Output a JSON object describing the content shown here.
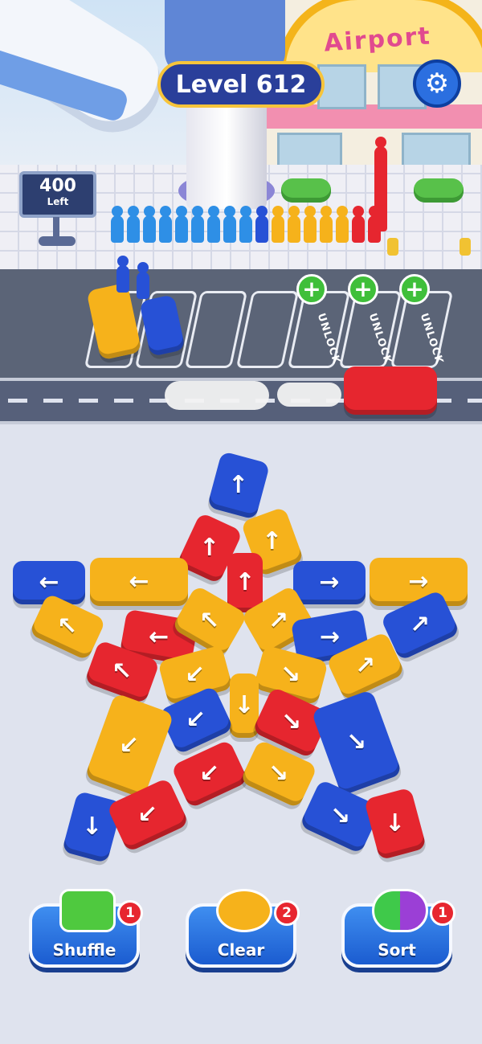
{
  "hud": {
    "level_label": "Level 612",
    "settings_icon": "gear-icon",
    "passengers_left_count": "400",
    "passengers_left_label": "Left"
  },
  "scene": {
    "terminal_sign": "Airport"
  },
  "parking": {
    "slots": [
      {
        "state": "occupied",
        "vehicle": "yellow-bus"
      },
      {
        "state": "occupied",
        "vehicle": "blue-car"
      },
      {
        "state": "empty"
      },
      {
        "state": "empty"
      },
      {
        "state": "locked",
        "label": "UNLOCK"
      },
      {
        "state": "locked",
        "label": "UNLOCK"
      },
      {
        "state": "locked",
        "label": "UNLOCK"
      }
    ]
  },
  "board": {
    "vehicles": [
      {
        "color": "blue",
        "arrow": "↑"
      },
      {
        "color": "red",
        "arrow": "↑"
      },
      {
        "color": "yellow",
        "arrow": "↑"
      },
      {
        "color": "red",
        "arrow": "↑"
      },
      {
        "color": "blue",
        "arrow": "←"
      },
      {
        "color": "yellow",
        "arrow": "←"
      },
      {
        "color": "blue",
        "arrow": "→"
      },
      {
        "color": "yellow",
        "arrow": "→"
      },
      {
        "color": "yellow",
        "arrow": "↖"
      },
      {
        "color": "red",
        "arrow": "←"
      },
      {
        "color": "yellow",
        "arrow": "↖"
      },
      {
        "color": "yellow",
        "arrow": "↗"
      },
      {
        "color": "blue",
        "arrow": "→"
      },
      {
        "color": "blue",
        "arrow": "↗"
      },
      {
        "color": "red",
        "arrow": "↖"
      },
      {
        "color": "yellow",
        "arrow": "↙"
      },
      {
        "color": "yellow",
        "arrow": "↘"
      },
      {
        "color": "yellow",
        "arrow": "↗"
      },
      {
        "color": "yellow",
        "arrow": "↓"
      },
      {
        "color": "blue",
        "arrow": "↙"
      },
      {
        "color": "red",
        "arrow": "↘"
      },
      {
        "color": "yellow",
        "arrow": "↙"
      },
      {
        "color": "blue",
        "arrow": "↘"
      },
      {
        "color": "red",
        "arrow": "↙"
      },
      {
        "color": "yellow",
        "arrow": "↘"
      },
      {
        "color": "blue",
        "arrow": "↓"
      },
      {
        "color": "red",
        "arrow": "↙"
      },
      {
        "color": "blue",
        "arrow": "↘"
      },
      {
        "color": "red",
        "arrow": "↓"
      }
    ]
  },
  "boosters": {
    "shuffle": {
      "label": "Shuffle",
      "count": "1",
      "icon": "green-car-shuffle-icon"
    },
    "clear": {
      "label": "Clear",
      "count": "2",
      "icon": "helicopter-icon"
    },
    "sort": {
      "label": "Sort",
      "count": "1",
      "icon": "people-sort-icon"
    }
  },
  "colors": {
    "blue": "#2751d6",
    "yellow": "#f6b21b",
    "red": "#e6262f",
    "accent": "#2a3f9a",
    "badge": "#e7262f",
    "unlock_green": "#3fbf3a"
  }
}
